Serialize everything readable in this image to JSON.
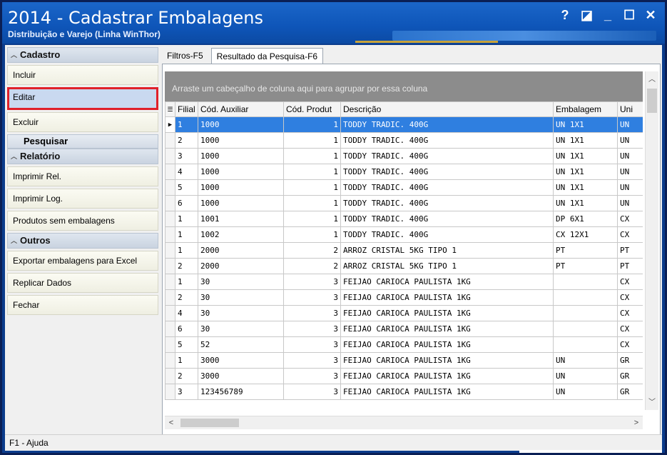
{
  "window": {
    "title": "2014 - Cadastrar Embalagens",
    "subtitle": "Distribuição e Varejo (Linha WinThor)",
    "buttons": [
      "?",
      "◪",
      "_",
      "☐",
      "✕"
    ]
  },
  "sidebar": {
    "cadastro": {
      "header": "Cadastro",
      "items": [
        "Incluir",
        "Editar",
        "Excluir"
      ],
      "active": "Editar"
    },
    "pesquisar": "Pesquisar",
    "relatorio": {
      "header": "Relatório",
      "items": [
        "Imprimir Rel.",
        "Imprimir Log.",
        "Produtos sem embalagens"
      ]
    },
    "outros": {
      "header": "Outros",
      "items": [
        "Exportar embalagens para Excel",
        "Replicar Dados",
        "Fechar"
      ]
    }
  },
  "tabs": [
    "Filtros-F5",
    "Resultado da Pesquisa-F6"
  ],
  "grid": {
    "group_hint": "Arraste um cabeçalho de coluna aqui para agrupar por essa coluna",
    "columns": [
      "Filial",
      "Cód. Auxiliar",
      "Cód. Produt",
      "Descrição",
      "Embalagem",
      "Uni"
    ],
    "rows": [
      [
        "1",
        "1000",
        "1",
        "TODDY TRADIC. 400G",
        "UN 1X1",
        "UN"
      ],
      [
        "2",
        "1000",
        "1",
        "TODDY TRADIC. 400G",
        "UN 1X1",
        "UN"
      ],
      [
        "3",
        "1000",
        "1",
        "TODDY TRADIC. 400G",
        "UN 1X1",
        "UN"
      ],
      [
        "4",
        "1000",
        "1",
        "TODDY TRADIC. 400G",
        "UN 1X1",
        "UN"
      ],
      [
        "5",
        "1000",
        "1",
        "TODDY TRADIC. 400G",
        "UN 1X1",
        "UN"
      ],
      [
        "6",
        "1000",
        "1",
        "TODDY TRADIC. 400G",
        "UN 1X1",
        "UN"
      ],
      [
        "1",
        "1001",
        "1",
        "TODDY TRADIC. 400G",
        "DP 6X1",
        "CX"
      ],
      [
        "1",
        "1002",
        "1",
        "TODDY TRADIC. 400G",
        "CX 12X1",
        "CX"
      ],
      [
        "1",
        "2000",
        "2",
        "ARROZ CRISTAL 5KG TIPO 1",
        "PT",
        "PT"
      ],
      [
        "2",
        "2000",
        "2",
        "ARROZ CRISTAL 5KG TIPO 1",
        "PT",
        "PT"
      ],
      [
        "1",
        "30",
        "3",
        "FEIJAO CARIOCA PAULISTA 1KG",
        "",
        "CX"
      ],
      [
        "2",
        "30",
        "3",
        "FEIJAO CARIOCA PAULISTA 1KG",
        "",
        "CX"
      ],
      [
        "4",
        "30",
        "3",
        "FEIJAO CARIOCA PAULISTA 1KG",
        "",
        "CX"
      ],
      [
        "6",
        "30",
        "3",
        "FEIJAO CARIOCA PAULISTA 1KG",
        "",
        "CX"
      ],
      [
        "5",
        "52",
        "3",
        "FEIJAO CARIOCA PAULISTA 1KG",
        "",
        "CX"
      ],
      [
        "1",
        "3000",
        "3",
        "FEIJAO CARIOCA PAULISTA 1KG",
        "UN",
        "GR"
      ],
      [
        "2",
        "3000",
        "3",
        "FEIJAO CARIOCA PAULISTA 1KG",
        "UN",
        "GR"
      ],
      [
        "3",
        "123456789",
        "3",
        "FEIJAO CARIOCA PAULISTA 1KG",
        "UN",
        "GR"
      ]
    ],
    "selected_row": 0
  },
  "status": "F1 - Ajuda",
  "colors": {
    "title_bg": "#0e55b8",
    "selection": "#2f7fe0",
    "active_outline": "#e0202a"
  }
}
